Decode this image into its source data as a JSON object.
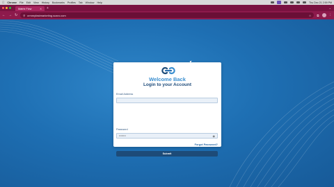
{
  "macos_menubar": {
    "app_name": "Chrome",
    "menu_items": [
      "File",
      "Edit",
      "View",
      "History",
      "Bookmarks",
      "Profiles",
      "Tab",
      "Window",
      "Help"
    ],
    "clock": "Thu Dec 21 2:59 PM"
  },
  "browser": {
    "tab_title": "Matrix Flow",
    "new_tab_symbol": "+",
    "url": "crmmyfastmarketing.scaro.com",
    "colors": {
      "tabbar": "#7a1240",
      "urlbar": "#8d1a4c"
    }
  },
  "login": {
    "welcome": "Welcome Back",
    "subtitle": "Login to your Account",
    "email_label": "Email Address",
    "email_value": "",
    "password_label": "Password",
    "password_value": "••••••••",
    "forgot_label": "Forgot Password?",
    "submit_label": "Submit"
  },
  "colors": {
    "background": "#1e6fb3",
    "accent": "#3b8fd0",
    "button": "#1d4b78"
  }
}
